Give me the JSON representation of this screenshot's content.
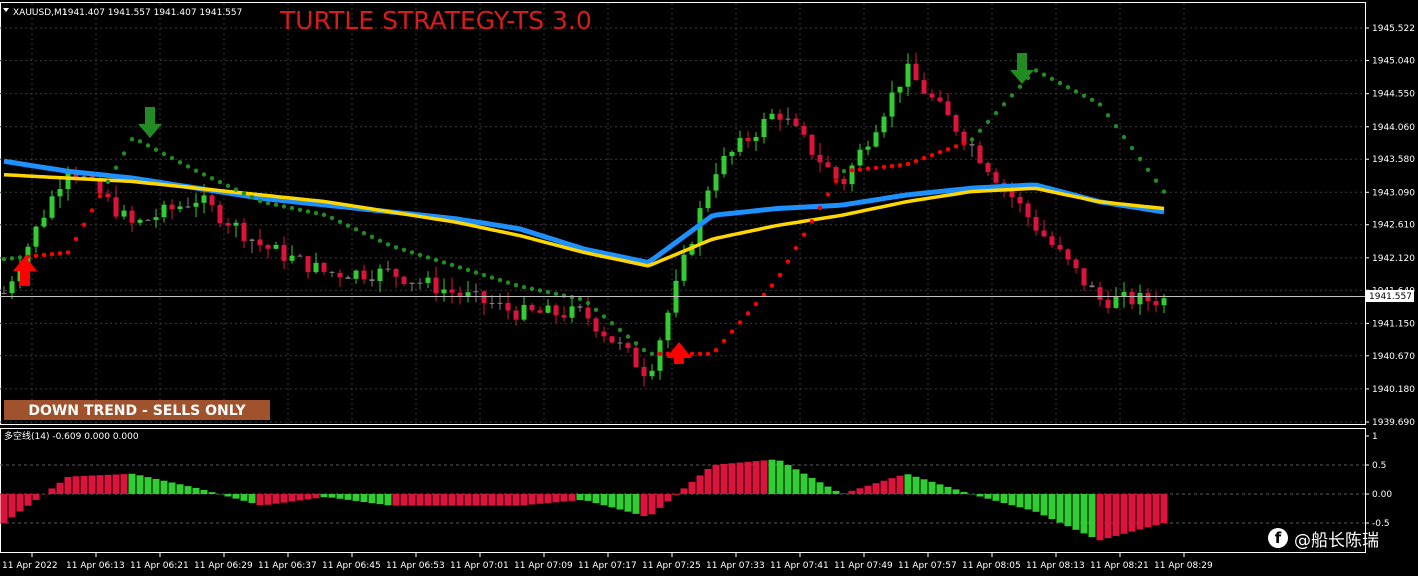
{
  "header": {
    "symbol": "XAUUSD,M1",
    "ohlc": "1941.407 1941.557 1941.407 1941.557",
    "strategy_title": "TURTLE STRATEGY-TS 3.0"
  },
  "trend_box": {
    "label": "DOWN TREND - SELLS ONLY",
    "color": "#a0522d"
  },
  "price_axis": {
    "ticks": [
      "1945.522",
      "1945.040",
      "1944.550",
      "1944.060",
      "1943.580",
      "1943.090",
      "1942.610",
      "1942.120",
      "1941.640",
      "1941.150",
      "1940.670",
      "1940.180",
      "1939.690"
    ],
    "current_price": "1941.557"
  },
  "time_axis": {
    "ticks": [
      "11 Apr 2022",
      "11 Apr 06:13",
      "11 Apr 06:21",
      "11 Apr 06:29",
      "11 Apr 06:37",
      "11 Apr 06:45",
      "11 Apr 06:53",
      "11 Apr 07:01",
      "11 Apr 07:09",
      "11 Apr 07:17",
      "11 Apr 07:25",
      "11 Apr 07:33",
      "11 Apr 07:41",
      "11 Apr 07:49",
      "11 Apr 07:57",
      "11 Apr 08:05",
      "11 Apr 08:13",
      "11 Apr 08:21",
      "11 Apr 08:29"
    ]
  },
  "indicator": {
    "header": "多空线(14) -0.609 0.000 0.000",
    "ticks": [
      "1",
      "0.5",
      "0.00",
      "-0.5"
    ]
  },
  "watermark": {
    "text": "@船长陈瑞",
    "icon": "facebook-icon"
  },
  "colors": {
    "background": "#000000",
    "bull_candle": "#32cd32",
    "bear_candle": "#dc143c",
    "neutral_candle": "#808080",
    "ema_blue": "#1e90ff",
    "ema_yellow": "#ffd700",
    "trail_red": "#ff0000",
    "trail_green": "#228b22",
    "arrow_up": "#ff0000",
    "arrow_down": "#228b22"
  },
  "chart_data": [
    {
      "type": "candlestick",
      "title": "XAUUSD,M1",
      "ylim": [
        1939.69,
        1945.522
      ],
      "x": [
        "11 Apr 2022",
        "11 Apr 06:13",
        "11 Apr 06:21",
        "11 Apr 06:29",
        "11 Apr 06:37",
        "11 Apr 06:45",
        "11 Apr 06:53",
        "11 Apr 07:01",
        "11 Apr 07:09",
        "11 Apr 07:17",
        "11 Apr 07:25",
        "11 Apr 07:33",
        "11 Apr 07:41",
        "11 Apr 07:49",
        "11 Apr 07:57",
        "11 Apr 08:05",
        "11 Apr 08:13",
        "11 Apr 08:21",
        "11 Apr 08:29"
      ],
      "close": [
        1941.6,
        1943.5,
        1942.6,
        1943.0,
        1942.3,
        1941.9,
        1941.9,
        1941.6,
        1941.3,
        1941.3,
        1940.4,
        1943.4,
        1944.3,
        1943.2,
        1944.9,
        1943.8,
        1942.6,
        1941.5,
        1941.5
      ],
      "series": [
        {
          "name": "EMA blue",
          "values": [
            1943.55,
            1943.4,
            1943.3,
            1943.15,
            1943.0,
            1942.9,
            1942.8,
            1942.7,
            1942.55,
            1942.25,
            1942.05,
            1942.75,
            1942.85,
            1942.9,
            1943.05,
            1943.15,
            1943.2,
            1942.95,
            1942.8
          ]
        },
        {
          "name": "EMA yellow",
          "values": [
            1943.35,
            1943.3,
            1943.25,
            1943.15,
            1943.05,
            1942.95,
            1942.8,
            1942.65,
            1942.45,
            1942.2,
            1942.0,
            1942.4,
            1942.6,
            1942.75,
            1942.95,
            1943.1,
            1943.15,
            1942.95,
            1942.85
          ]
        },
        {
          "name": "Trail stop",
          "values": [
            1942.1,
            1942.2,
            1943.9,
            1943.4,
            1942.95,
            1942.75,
            1942.3,
            1942.0,
            1941.7,
            1941.5,
            1940.7,
            1940.7,
            1941.8,
            1943.4,
            1943.5,
            1943.85,
            1944.9,
            1944.4,
            1943.1
          ]
        }
      ]
    },
    {
      "type": "bar",
      "title": "多空线(14)",
      "ylim": [
        -1,
        1
      ],
      "values": [
        -0.5,
        0.3,
        0.35,
        0.1,
        -0.2,
        -0.05,
        -0.2,
        -0.2,
        -0.2,
        -0.1,
        -0.4,
        0.5,
        0.6,
        0.0,
        0.35,
        0.0,
        -0.3,
        -0.8,
        -0.5
      ]
    }
  ]
}
